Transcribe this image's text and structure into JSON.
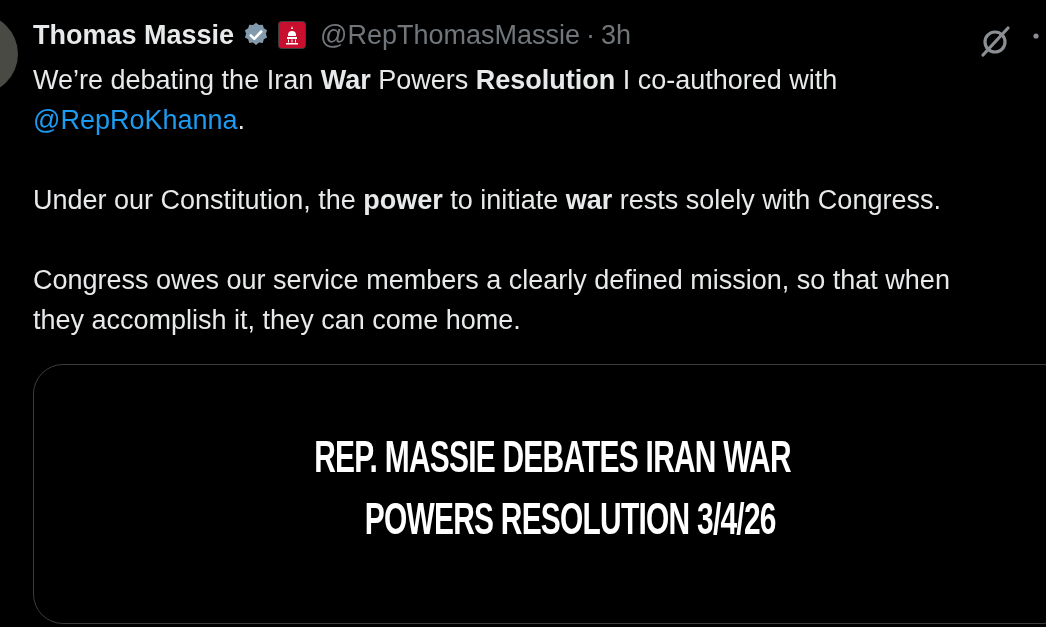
{
  "post": {
    "author": {
      "name": "Thomas Massie",
      "verified": true,
      "handle": "@RepThomasMassie",
      "separator": "·",
      "time": "3h"
    },
    "paragraphs": [
      {
        "text": "We’re debating the Iran **War** Powers **Resolution** I co-authored with ",
        "mention": "@RepRoKhanna",
        "after": "."
      },
      {
        "text": "Under our Constitution, the **power** to initiate **war** rests solely with Congress."
      },
      {
        "text": "Congress owes our service members a clearly defined mission, so that when they accomplish it, they can come home."
      }
    ],
    "media_card": {
      "headline_lines": [
        "REP. MASSIE DEBATES IRAN WAR",
        "POWERS RESOLUTION 3/4/26"
      ]
    }
  }
}
